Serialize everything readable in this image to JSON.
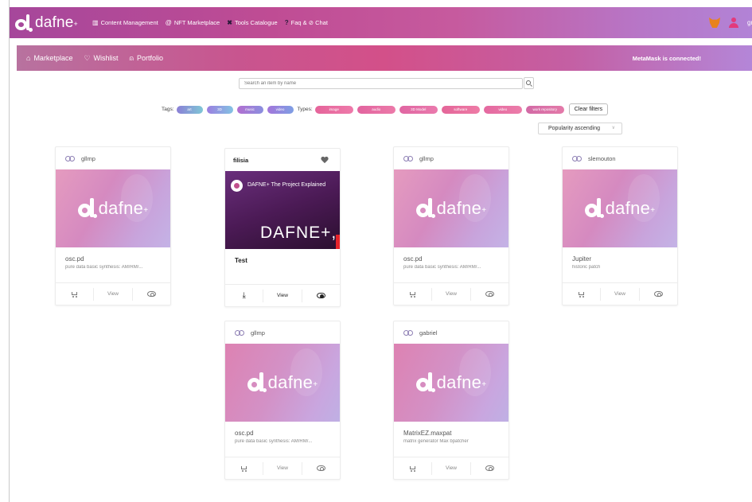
{
  "brand": {
    "name": "dafne",
    "suffix": "+"
  },
  "topnav": [
    {
      "icon": "grid-icon",
      "label": "Content Management"
    },
    {
      "icon": "nft-icon",
      "label": "NFT Marketplace"
    },
    {
      "icon": "tools-icon",
      "label": "Tools Catalogue"
    },
    {
      "icon": "question-icon",
      "label": "Faq & ⊘ Chat"
    }
  ],
  "user": {
    "name": "greg"
  },
  "subnav": [
    {
      "icon": "home-icon",
      "label": "Marketplace"
    },
    {
      "icon": "heart-icon",
      "label": "Wishlist"
    },
    {
      "icon": "person-icon",
      "label": "Portfolio"
    }
  ],
  "metamask_status": "MetaMask is connected!",
  "search": {
    "placeholder": "Search an item by name"
  },
  "filters": {
    "tags_label": "Tags:",
    "types_label": "Types:",
    "tags": [
      {
        "label": "art",
        "color": "#7fa5d8"
      },
      {
        "label": "3D",
        "color": "#86b8e8"
      },
      {
        "label": "music",
        "color": "#a179d4"
      },
      {
        "label": "video",
        "color": "#8f86dc"
      }
    ],
    "types": [
      {
        "label": "image",
        "color": "#e8649b"
      },
      {
        "label": "audio",
        "color": "#e46aa0"
      },
      {
        "label": "3D Model",
        "color": "#e36ca3"
      },
      {
        "label": "software",
        "color": "#e96b9c"
      },
      {
        "label": "video",
        "color": "#e86ea1"
      },
      {
        "label": "work repository",
        "color": "#dd6fa8"
      }
    ],
    "clear_label": "Clear filters"
  },
  "sort": {
    "selected": "Popularity ascending"
  },
  "cards": [
    {
      "owner": "gllmp",
      "title": "osc.pd",
      "desc": "pure data basic synthesis: AM/RM/...",
      "view": "View"
    },
    {
      "owner": "filisia",
      "title": "Test",
      "desc": "",
      "view": "View",
      "video_title": "DAFNE+ The Project Explained",
      "video_big": "DAFNE+, T"
    },
    {
      "owner": "gllmp",
      "title": "osc.pd",
      "desc": "pure data basic synthesis: AM/RM/...",
      "view": "View"
    },
    {
      "owner": "slemouton",
      "title": "Jupiter",
      "desc": "historic patch",
      "view": "View"
    },
    {
      "owner": "gllmp",
      "title": "osc.pd",
      "desc": "pure data basic synthesis: AM/RM/...",
      "view": "View"
    },
    {
      "owner": "gabriel",
      "title": "MatrixEZ.maxpat",
      "desc": "matrix generator Max bpatcher",
      "view": "View"
    }
  ]
}
